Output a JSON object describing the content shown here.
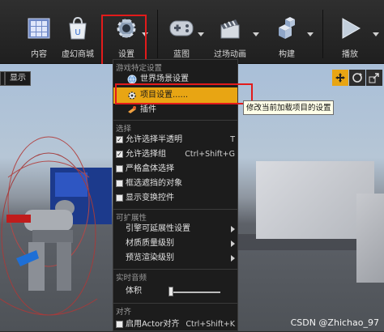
{
  "toolbar": {
    "buttons": [
      {
        "label": "内容",
        "icon": "content-grid-icon"
      },
      {
        "label": "虚幻商城",
        "icon": "marketplace-bag-icon"
      },
      {
        "label": "设置",
        "icon": "settings-gear-icon"
      },
      {
        "label": "蓝图",
        "icon": "blueprint-gamepad-icon"
      },
      {
        "label": "过场动画",
        "icon": "cinematics-clapper-icon"
      },
      {
        "label": "构建",
        "icon": "build-cubes-icon"
      },
      {
        "label": "播放",
        "icon": "play-icon"
      }
    ]
  },
  "viewport": {
    "display_button": "显示",
    "gizmos": [
      "translate-icon",
      "rotate-icon",
      "scale-icon"
    ]
  },
  "menu": {
    "section_game": "游戏特定设置",
    "world_settings": "世界场景设置",
    "project_settings": "项目设置......",
    "plugins": "插件",
    "section_select": "选择",
    "allow_translucent": {
      "label": "允许选择半透明",
      "shortcut": "T",
      "checked": true
    },
    "allow_group": {
      "label": "允许选择组",
      "shortcut": "Ctrl+Shift+G",
      "checked": true
    },
    "strict_box": {
      "label": "严格盒体选择",
      "checked": false
    },
    "box_occluded": {
      "label": "框选遮挡的对象",
      "checked": false
    },
    "show_transform": {
      "label": "显示变换控件",
      "checked": false
    },
    "section_scalability": "可扩展性",
    "engine_scalability": "引擎可延展性设置",
    "material_quality": "材质质量级别",
    "preview_rendering": "预览渲染级别",
    "section_audio": "实时音频",
    "volume_label": "体积",
    "volume_level": 0.0,
    "section_snap": "对齐",
    "enable_actor_snap": {
      "label": "启用Actor对齐",
      "shortcut": "Ctrl+Shift+K",
      "checked": false
    }
  },
  "tooltip": "修改当前加载项目的设置",
  "watermark": "CSDN @Zhichao_97",
  "colors": {
    "highlight": "#e8a513",
    "callout": "#e21b1b"
  }
}
